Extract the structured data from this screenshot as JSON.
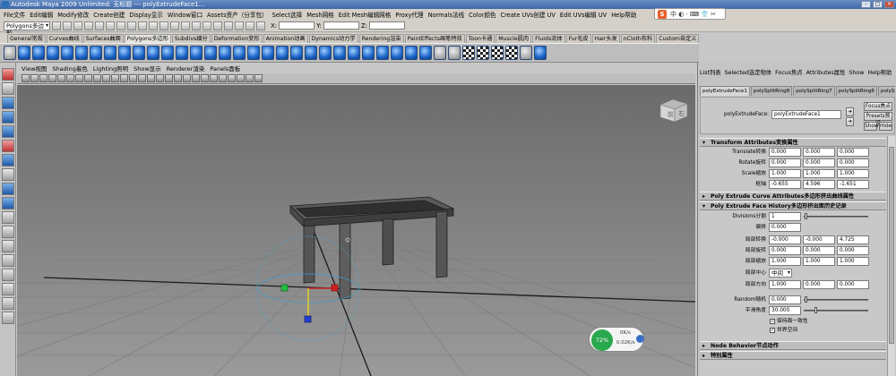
{
  "window": {
    "title": "Autodesk Maya 2009 Unlimited: 无标题    ---    polyExtrudeFace1..."
  },
  "menubar": {
    "items": [
      "File文件",
      "Edit编辑",
      "Modify修改",
      "Create创建",
      "Display显示",
      "Window窗口",
      "Assets资产（分享包）",
      "Select选择",
      "Mesh网格",
      "Edit Mesh编辑网格",
      "Proxy代理",
      "Normals法线",
      "Color颜色",
      "Create UVs创建 UV",
      "Edit UVs编辑 UV",
      "Help帮助"
    ]
  },
  "ime": {
    "logo": "S",
    "label": "中 ◐ · ⌨ 👕 ✂"
  },
  "statusline": {
    "mode": "Polygons多边形",
    "x_label": "X:",
    "y_label": "Y:",
    "z_label": "Z:"
  },
  "shelf_tabs": [
    "General常规",
    "Curves曲线",
    "Surfaces曲面",
    "Polygons多边形",
    "Subdivs细分",
    "Deformation变形",
    "Animation动画",
    "Dynamics动力学",
    "Rendering渲染",
    "PaintEffects画笔特效",
    "Toon卡通",
    "Muscle肌肉",
    "Fluids流体",
    "Fur毛皮",
    "Hair头发",
    "nCloth布料",
    "Custom自定义"
  ],
  "shelf_active": "Polygons多边形",
  "viewport": {
    "menu": [
      "View视图",
      "Shading着色",
      "Lighting照明",
      "Show显示",
      "Renderer渲染",
      "Panels面板"
    ],
    "viewcube_front": "前",
    "viewcube_right": "右"
  },
  "memory_widget": {
    "percent": "72%",
    "up": "0K/s",
    "down": "0.02K/s"
  },
  "attribute_editor": {
    "menu": [
      "List列表",
      "Selected选定物体",
      "Focus焦点",
      "Attributes属性",
      "Show",
      "Help帮助"
    ],
    "tabs": [
      "polyExtrudeFace1",
      "polySplitRing8",
      "polySplitRing7",
      "polySplitRing6",
      "polySplit"
    ],
    "node_label": "polyExtrudeFace:",
    "node_value": "polyExtrudeFace1",
    "focus_button": "Focus焦点",
    "presets_button": "Presets预设",
    "show_button": "Show",
    "hide_button": "Hide",
    "sections": {
      "transform": {
        "title": "Transform Attributes变换属性",
        "rows": [
          {
            "label": "Translate转换",
            "values": [
              "0.000",
              "0.000",
              "0.000"
            ]
          },
          {
            "label": "Rotate旋转",
            "values": [
              "0.000",
              "0.000",
              "0.000"
            ]
          },
          {
            "label": "Scale缩放",
            "values": [
              "1.000",
              "1.000",
              "1.000"
            ]
          },
          {
            "label": "枢轴",
            "values": [
              "-0.655",
              "4.596",
              "-1.651"
            ]
          }
        ]
      },
      "curve": {
        "title": "Poly Extrude Curve Attributes多边形挤出曲线属性"
      },
      "history": {
        "title": "Poly Extrude Face History多边形挤出面历史记录",
        "divisions_label": "Divisions分割",
        "divisions_value": "1",
        "offset_label": "偏移",
        "offset_value": "0.000",
        "rows": [
          {
            "label": "局部转换",
            "values": [
              "-0.000",
              "-0.000",
              "4.725"
            ]
          },
          {
            "label": "局部旋转",
            "values": [
              "0.000",
              "0.000",
              "0.000"
            ]
          },
          {
            "label": "局部缩放",
            "values": [
              "1.000",
              "1.000",
              "1.000"
            ]
          }
        ],
        "center_label": "局部中心",
        "center_value": "中间",
        "direction_label": "局部方向",
        "direction_values": [
          "1.000",
          "0.000",
          "0.000"
        ],
        "random_label": "Random随机",
        "random_value": "0.000",
        "smooth_label": "平滑角度",
        "smooth_value": "30.000",
        "keep_label": "保持面一致性",
        "world_label": "世界空间"
      },
      "node_behavior": {
        "title": "Node Behavior节点动作"
      },
      "extra": {
        "title": "特别属性"
      }
    }
  }
}
